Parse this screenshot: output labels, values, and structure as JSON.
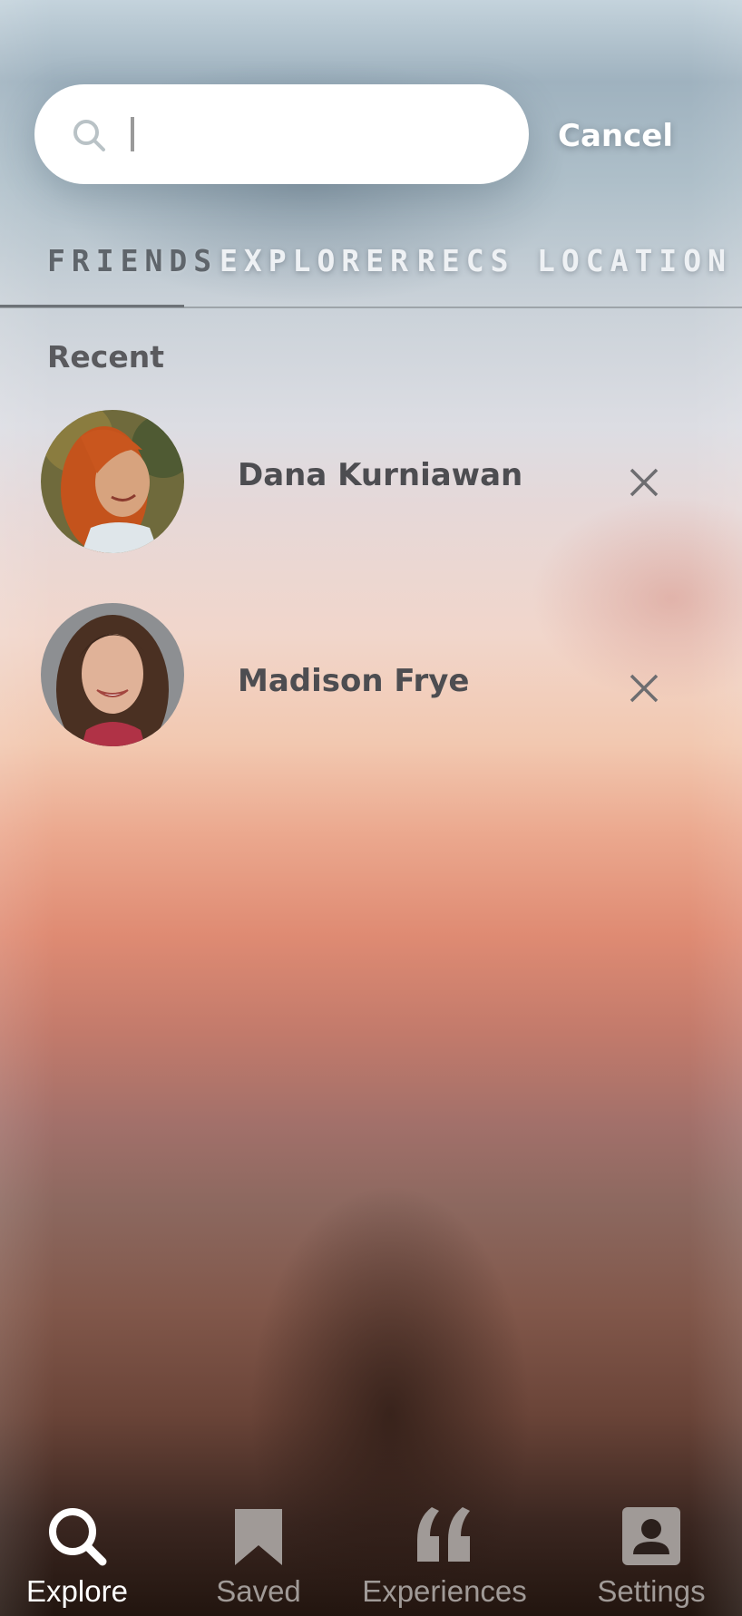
{
  "search": {
    "value": "",
    "placeholder": "",
    "cancel_label": "Cancel"
  },
  "tabs": [
    {
      "label": "FRIENDS",
      "active": true
    },
    {
      "label": "EXPLORER",
      "active": false
    },
    {
      "label": "RECS",
      "active": false
    },
    {
      "label": "LOCATION",
      "active": false
    }
  ],
  "recent": {
    "title": "Recent",
    "items": [
      {
        "name": "Dana Kurniawan",
        "avatar_icon": "avatar-photo"
      },
      {
        "name": "Madison Frye",
        "avatar_icon": "avatar-photo"
      }
    ]
  },
  "nav": [
    {
      "label": "Explore",
      "icon": "search-icon",
      "active": true
    },
    {
      "label": "Saved",
      "icon": "bookmark-icon",
      "active": false
    },
    {
      "label": "Experiences",
      "icon": "quote-icon",
      "active": false
    },
    {
      "label": "Settings",
      "icon": "profile-icon",
      "active": false
    }
  ],
  "colors": {
    "active_nav": "#ffffff",
    "inactive_nav": "#a09a97",
    "active_tab": "#5f656b",
    "inactive_tab": "#eef1f4"
  }
}
